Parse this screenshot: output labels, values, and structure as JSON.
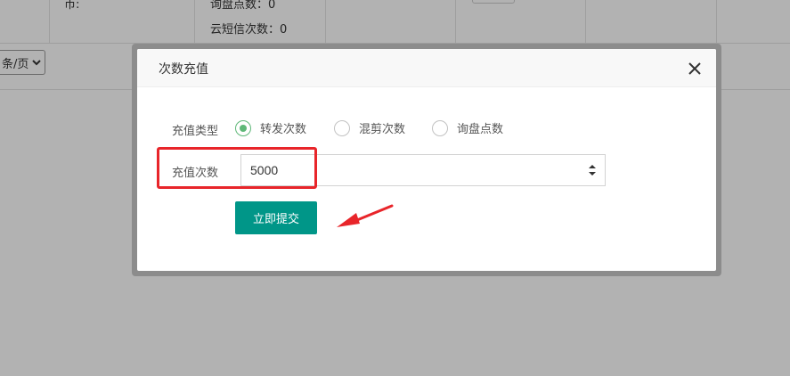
{
  "background": {
    "col1_text": "币:",
    "col2_line1": "询盘点数：0",
    "col2_line2": "云短信次数：0",
    "pager_label": "条/页"
  },
  "modal": {
    "title": "次数充值",
    "type_label": "充值类型",
    "options": [
      {
        "label": "转发次数",
        "checked": true
      },
      {
        "label": "混剪次数",
        "checked": false
      },
      {
        "label": "询盘点数",
        "checked": false
      }
    ],
    "count_label": "充值次数",
    "count_value": "5000",
    "submit_label": "立即提交"
  },
  "colors": {
    "accent": "#009688",
    "radio_checked": "#5fb878",
    "annotation_red": "#e8252a"
  },
  "icons": [
    "close-icon",
    "chevron-down-icon",
    "spinner-icon",
    "arrow-annotation-icon"
  ]
}
